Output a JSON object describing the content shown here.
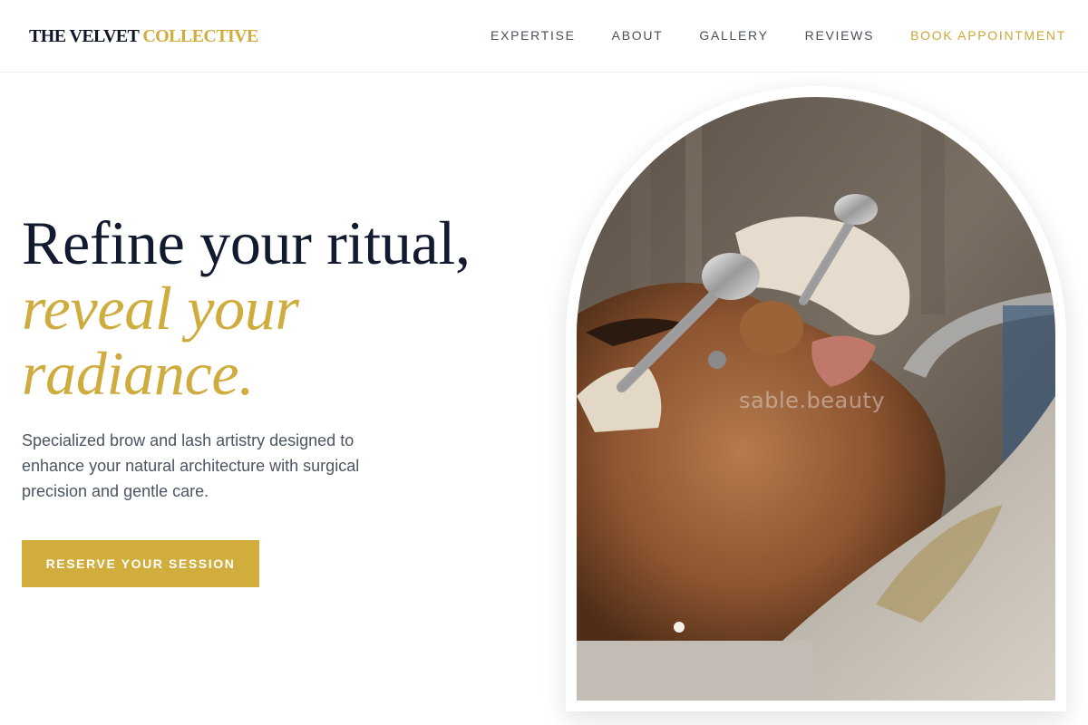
{
  "brand": {
    "name_primary": "THE VELVET",
    "name_accent": "COLLECTIVE"
  },
  "nav": {
    "items": [
      "EXPERTISE",
      "ABOUT",
      "GALLERY",
      "REVIEWS"
    ],
    "cta": "BOOK APPOINTMENT"
  },
  "hero": {
    "headline_line1": "Refine your ritual,",
    "headline_line2": "reveal your",
    "headline_line3": "radiance.",
    "subtext": "Specialized brow and lash artistry designed to enhance your natural architecture with surgical precision and gentle care.",
    "cta_label": "RESERVE YOUR SESSION",
    "image_watermark": "sable.beauty"
  },
  "colors": {
    "accent_gold": "#d0ad3c",
    "navy": "#111a2e",
    "body_text": "#4b5563"
  }
}
